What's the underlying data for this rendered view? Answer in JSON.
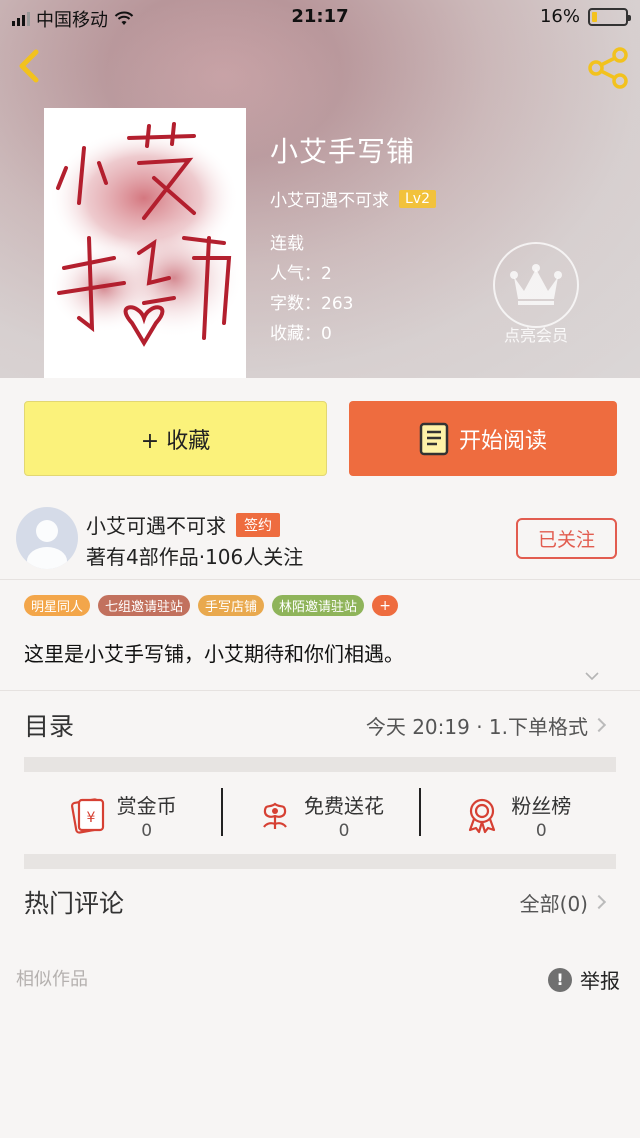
{
  "status_bar": {
    "carrier": "中国移动",
    "time": "21:17",
    "battery_percent": "16%",
    "battery_level": 0.16
  },
  "book": {
    "title": "小艾手写铺",
    "author": "小艾可遇不可求",
    "level": "Lv2",
    "status": "连载",
    "popularity_label": "人气：2",
    "word_count_label": "字数：263",
    "favorites_label": "收藏：0",
    "vip_label": "点亮会员"
  },
  "actions": {
    "favorite_label": "+ 收藏",
    "read_label": "开始阅读"
  },
  "author_card": {
    "name": "小艾可遇不可求",
    "badge": "签约",
    "stats": "著有4部作品·106人关注",
    "follow_label": "已关注"
  },
  "tags": [
    {
      "label": "明星同人",
      "color": "#f3a64a"
    },
    {
      "label": "七组邀请驻站",
      "color": "#c2715e"
    },
    {
      "label": "手写店铺",
      "color": "#e9a94e"
    },
    {
      "label": "林陌邀请驻站",
      "color": "#8fb45a"
    }
  ],
  "tag_more": "+",
  "description": "这里是小艾手写铺，小艾期待和你们相遇。",
  "toc": {
    "title": "目录",
    "latest": "今天 20:19 · 1.下单格式"
  },
  "stats": [
    {
      "label": "赏金币",
      "value": "0",
      "icon": "red-envelope-icon"
    },
    {
      "label": "免费送花",
      "value": "0",
      "icon": "flower-icon"
    },
    {
      "label": "粉丝榜",
      "value": "0",
      "icon": "medal-icon"
    }
  ],
  "comments": {
    "title": "热门评论",
    "all_label": "全部(0)"
  },
  "similar_label": "相似作品",
  "report_label": "举报",
  "colors": {
    "accent": "#ee6c3f",
    "favorite_button": "#fbf27b",
    "follow_border": "#e25c4f",
    "back_icon": "#f2c21e"
  }
}
